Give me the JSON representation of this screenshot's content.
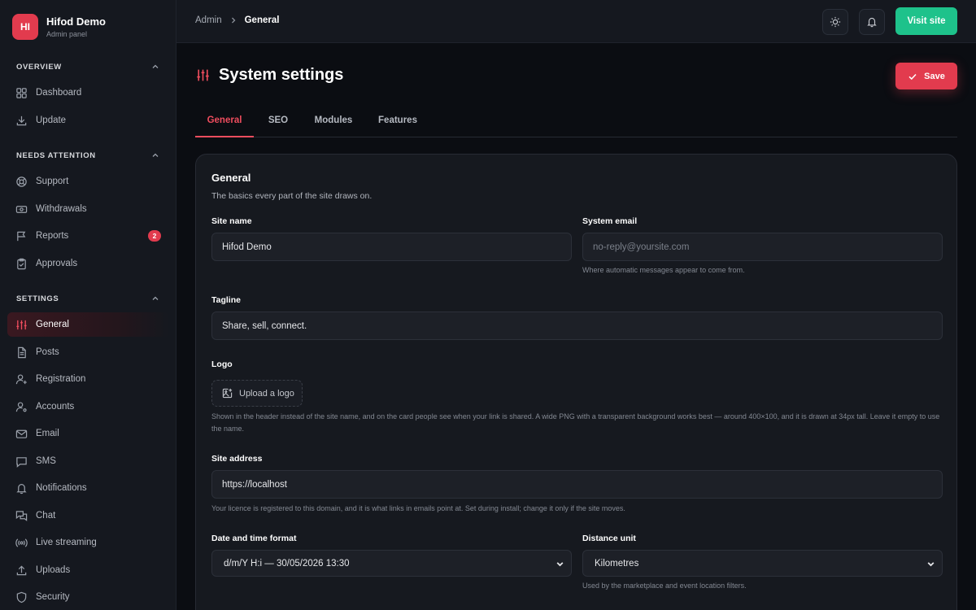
{
  "brand": {
    "initials": "HI",
    "name": "Hifod Demo",
    "subtitle": "Admin panel"
  },
  "sidebar": {
    "sections": [
      {
        "title": "OVERVIEW",
        "items": [
          {
            "label": "Dashboard",
            "icon": "dashboard-icon"
          },
          {
            "label": "Update",
            "icon": "download-icon"
          }
        ]
      },
      {
        "title": "NEEDS ATTENTION",
        "items": [
          {
            "label": "Support",
            "icon": "lifebuoy-icon"
          },
          {
            "label": "Withdrawals",
            "icon": "banknote-icon"
          },
          {
            "label": "Reports",
            "icon": "flag-icon",
            "badge": "2"
          },
          {
            "label": "Approvals",
            "icon": "clipboard-check-icon"
          }
        ]
      },
      {
        "title": "SETTINGS",
        "items": [
          {
            "label": "General",
            "icon": "sliders-icon",
            "active": true
          },
          {
            "label": "Posts",
            "icon": "document-icon"
          },
          {
            "label": "Registration",
            "icon": "user-plus-icon"
          },
          {
            "label": "Accounts",
            "icon": "user-gear-icon"
          },
          {
            "label": "Email",
            "icon": "mail-icon"
          },
          {
            "label": "SMS",
            "icon": "message-icon"
          },
          {
            "label": "Notifications",
            "icon": "bell-icon"
          },
          {
            "label": "Chat",
            "icon": "chat-icon"
          },
          {
            "label": "Live streaming",
            "icon": "broadcast-icon"
          },
          {
            "label": "Uploads",
            "icon": "upload-icon"
          },
          {
            "label": "Security",
            "icon": "shield-icon"
          }
        ]
      }
    ]
  },
  "topbar": {
    "breadcrumb": {
      "root": "Admin",
      "current": "General"
    },
    "visit_label": "Visit site"
  },
  "page": {
    "title": "System settings",
    "save_label": "Save"
  },
  "tabs": [
    {
      "label": "General",
      "active": true
    },
    {
      "label": "SEO"
    },
    {
      "label": "Modules"
    },
    {
      "label": "Features"
    }
  ],
  "card": {
    "title": "General",
    "description": "The basics every part of the site draws on.",
    "site_name": {
      "label": "Site name",
      "value": "Hifod Demo"
    },
    "system_email": {
      "label": "System email",
      "placeholder": "no-reply@yoursite.com",
      "help": "Where automatic messages appear to come from."
    },
    "tagline": {
      "label": "Tagline",
      "value": "Share, sell, connect."
    },
    "logo": {
      "label": "Logo",
      "button": "Upload a logo",
      "help": "Shown in the header instead of the site name, and on the card people see when your link is shared. A wide PNG with a transparent background works best — around 400×100, and it is drawn at 34px tall. Leave it empty to use the name."
    },
    "site_address": {
      "label": "Site address",
      "value": "https://localhost",
      "help": "Your licence is registered to this domain, and it is what links in emails point at. Set during install; change it only if the site moves."
    },
    "datetime_format": {
      "label": "Date and time format",
      "value": "d/m/Y H:i — 30/05/2026 13:30"
    },
    "distance_unit": {
      "label": "Distance unit",
      "value": "Kilometres",
      "help": "Used by the marketplace and event location filters."
    }
  },
  "colors": {
    "accent": "#e23b4e",
    "success": "#1ec28b",
    "background": "#0b0d12",
    "surface": "#15181f"
  }
}
